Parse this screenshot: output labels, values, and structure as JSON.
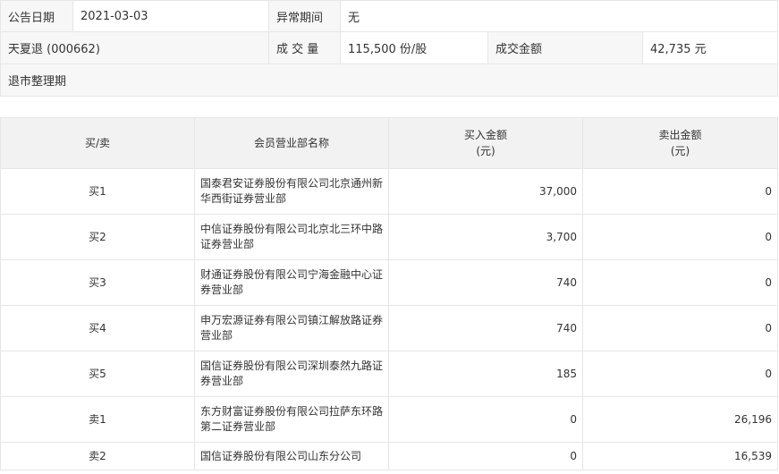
{
  "info": {
    "date_label": "公告日期",
    "date_value": "2021-03-03",
    "period_label": "异常期间",
    "period_value": "无",
    "stock": "天夏退 (000662)",
    "volume_label": "成 交 量",
    "volume_value": "115,500 份/股",
    "amount_label": "成交金额",
    "amount_value": "42,735 元",
    "reason": "退市整理期"
  },
  "table": {
    "headers": {
      "side": "买/卖",
      "branch": "会员营业部名称",
      "buy": "买入金额",
      "buy_unit": "(元)",
      "sell": "卖出金额",
      "sell_unit": "(元)"
    },
    "rows": [
      {
        "side": "买1",
        "branch": "国泰君安证券股份有限公司北京通州新华西街证券营业部",
        "buy": "37,000",
        "sell": "0"
      },
      {
        "side": "买2",
        "branch": "中信证券股份有限公司北京北三环中路证券营业部",
        "buy": "3,700",
        "sell": "0"
      },
      {
        "side": "买3",
        "branch": "财通证券股份有限公司宁海金融中心证券营业部",
        "buy": "740",
        "sell": "0"
      },
      {
        "side": "买4",
        "branch": "申万宏源证券有限公司镇江解放路证券营业部",
        "buy": "740",
        "sell": "0"
      },
      {
        "side": "买5",
        "branch": "国信证券股份有限公司深圳泰然九路证券营业部",
        "buy": "185",
        "sell": "0"
      },
      {
        "side": "卖1",
        "branch": "东方财富证券股份有限公司拉萨东环路第二证券营业部",
        "buy": "0",
        "sell": "26,196"
      },
      {
        "side": "卖2",
        "branch": "国信证券股份有限公司山东分公司",
        "buy": "0",
        "sell": "16,539"
      }
    ]
  }
}
